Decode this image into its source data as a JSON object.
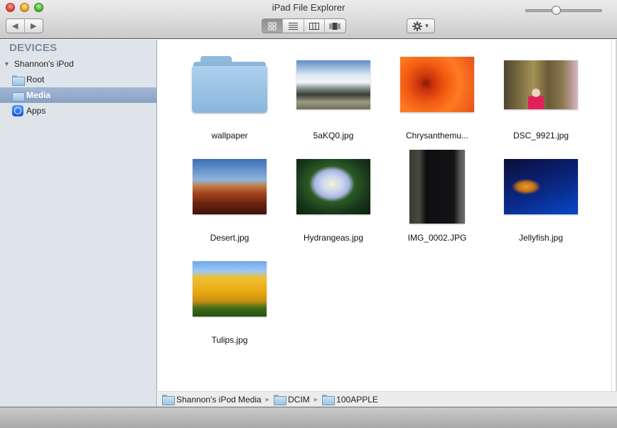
{
  "window": {
    "title": "iPad File Explorer"
  },
  "toolbar": {
    "back_icon": "◀",
    "forward_icon": "▶",
    "view_modes": [
      {
        "name": "icon-view",
        "active": true
      },
      {
        "name": "list-view",
        "active": false
      },
      {
        "name": "column-view",
        "active": false
      },
      {
        "name": "coverflow-view",
        "active": false
      }
    ],
    "action_menu_icon": "gear-icon"
  },
  "sidebar": {
    "header": "DEVICES",
    "device": "Shannon's iPod",
    "items": [
      {
        "label": "Root",
        "icon": "folder-icon",
        "selected": false
      },
      {
        "label": "Media",
        "icon": "folder-icon",
        "selected": true
      },
      {
        "label": "Apps",
        "icon": "app-store-icon",
        "selected": false
      }
    ]
  },
  "files": [
    {
      "name": "wallpaper",
      "type": "folder"
    },
    {
      "name": "5aKQ0.jpg",
      "type": "image"
    },
    {
      "name": "Chrysanthemu...",
      "type": "image"
    },
    {
      "name": "DSC_9921.jpg",
      "type": "image"
    },
    {
      "name": "Desert.jpg",
      "type": "image"
    },
    {
      "name": "Hydrangeas.jpg",
      "type": "image"
    },
    {
      "name": "IMG_0002.JPG",
      "type": "image"
    },
    {
      "name": "Jellyfish.jpg",
      "type": "image"
    },
    {
      "name": "Tulips.jpg",
      "type": "image"
    }
  ],
  "pathbar": {
    "crumbs": [
      "Shannon's iPod Media",
      "DCIM",
      "100APPLE"
    ]
  },
  "statusbar": {
    "icon_size_fraction": 0.4
  }
}
